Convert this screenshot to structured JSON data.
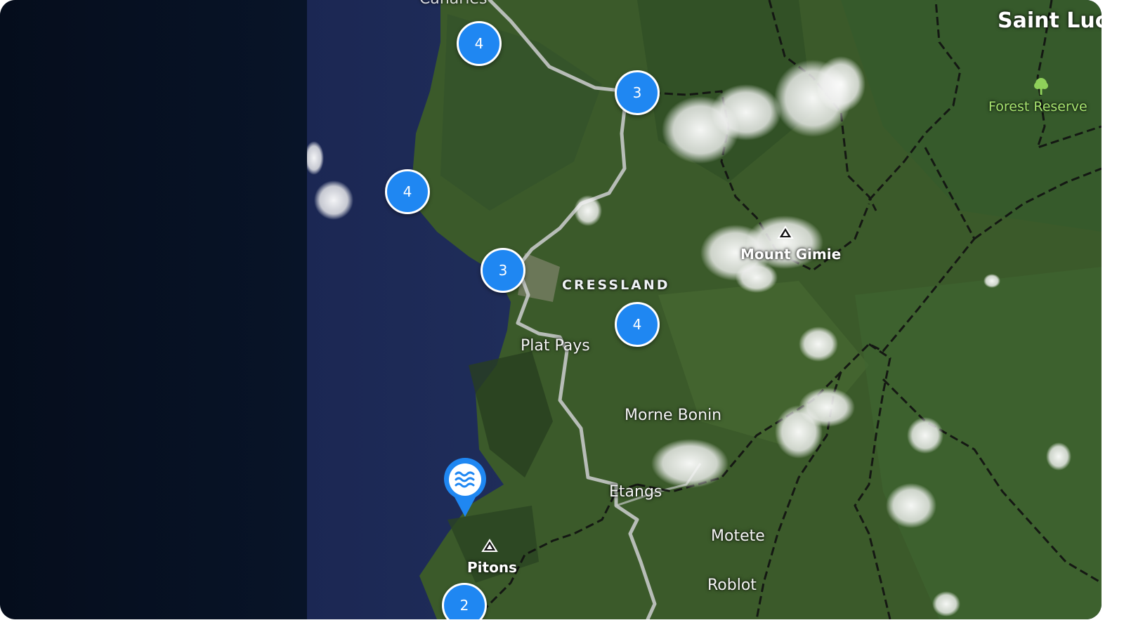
{
  "map": {
    "country_label": "Saint Luci",
    "top_partial_label": "Canaries",
    "region_label": "CRESSLAND",
    "places": [
      "Plat Pays",
      "Morne Bonin",
      "Etangs",
      "Motete",
      "Roblot"
    ],
    "peaks": [
      "Mount Gimie",
      "Pitons"
    ],
    "forest_reserve": "Forest Reserve",
    "clusters": [
      "4",
      "3",
      "4",
      "3",
      "4",
      "2"
    ],
    "water_pin_icon": "water-waves-icon",
    "colors": {
      "cluster_fill": "#1f87f2",
      "cluster_border": "#ffffff",
      "sea": "#1d2c5a",
      "land": "#3d5c2b",
      "forest_label": "#a7e36f",
      "side_panel": "#07101f"
    }
  }
}
